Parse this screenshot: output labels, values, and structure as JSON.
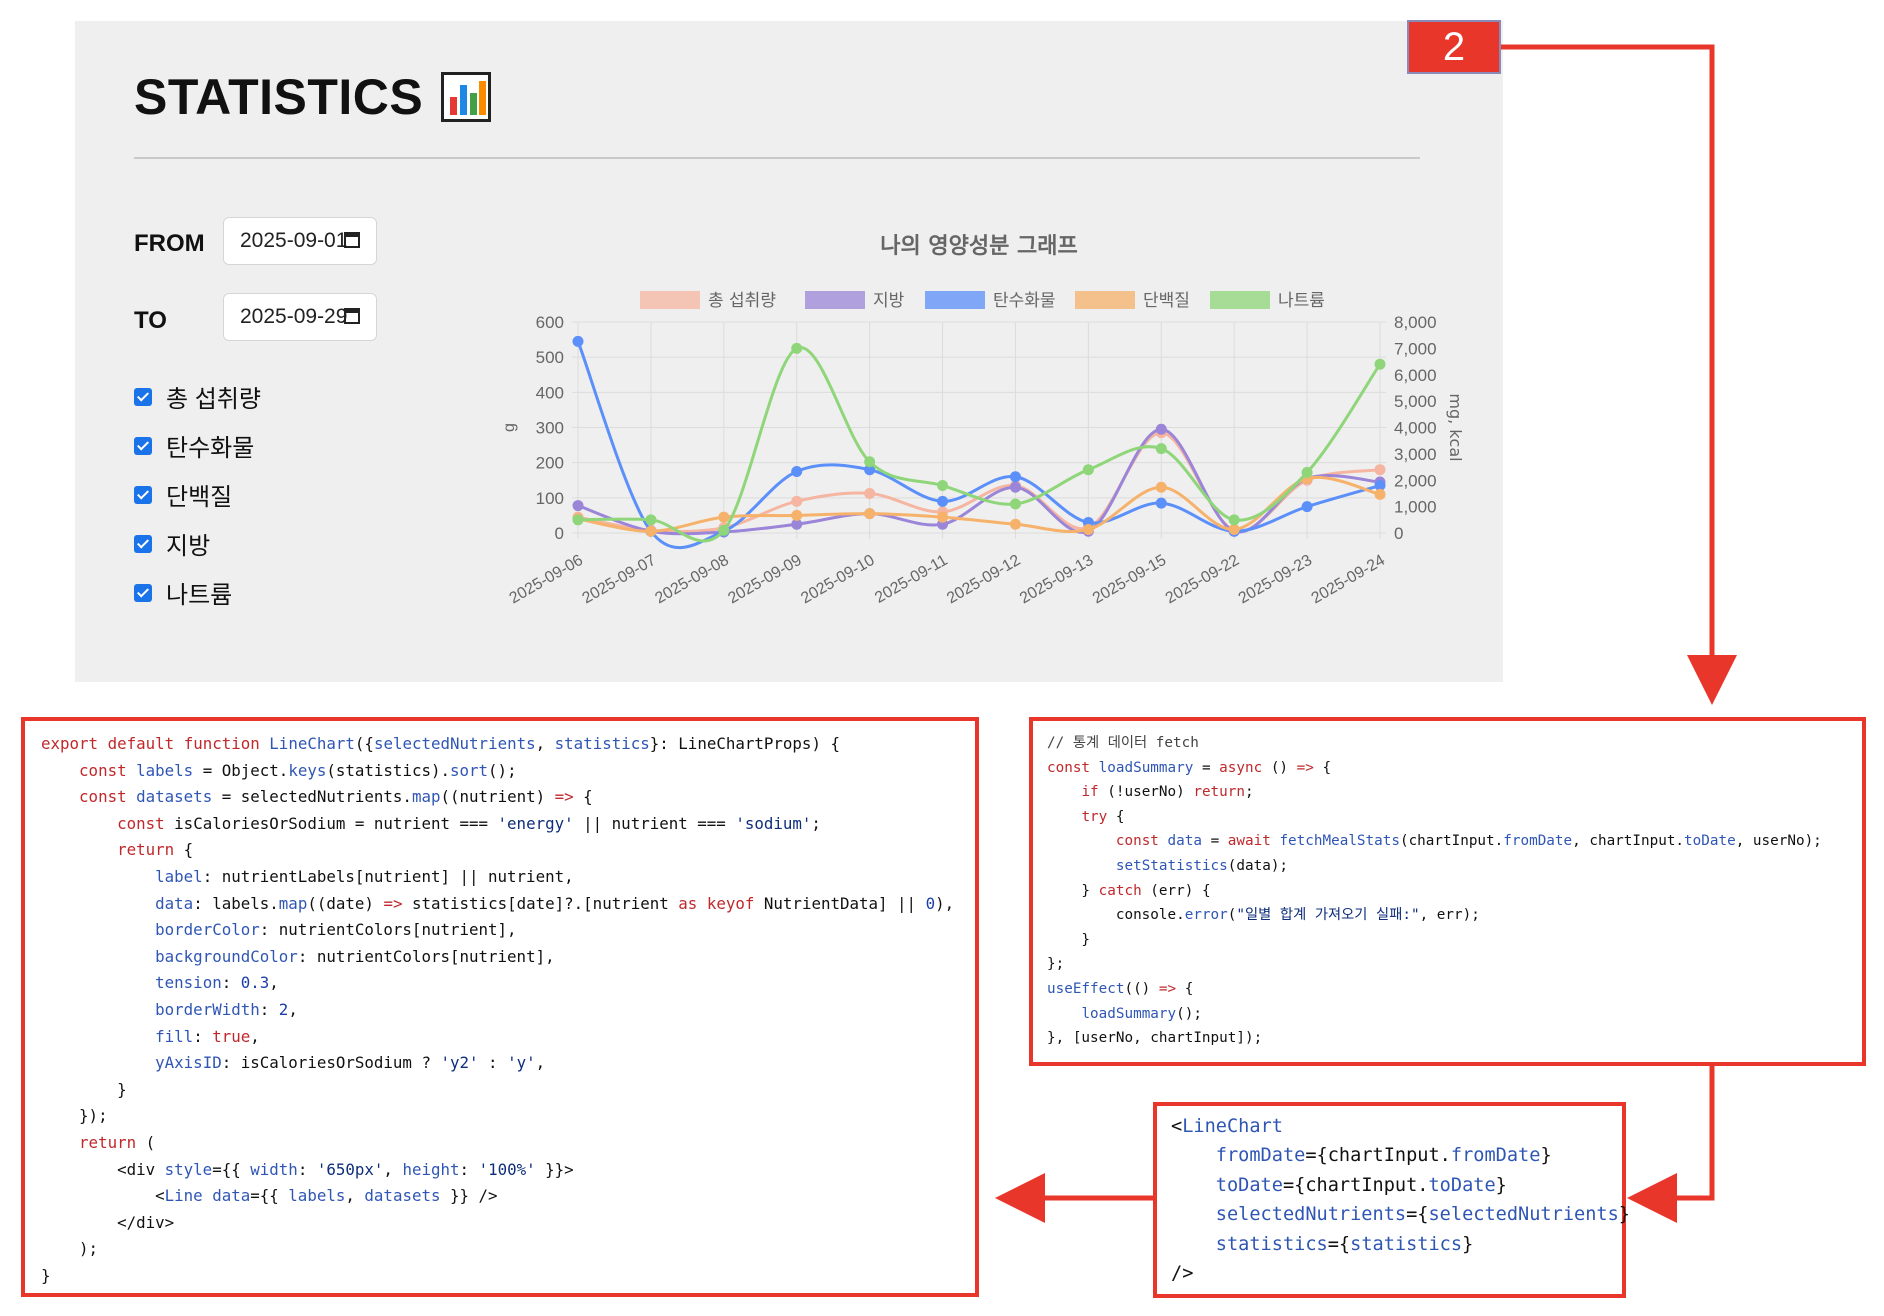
{
  "panel": {
    "title": "STATISTICS",
    "title_icon": "bar-chart-emoji-icon",
    "from_label": "FROM",
    "from_value": "2025-09-01",
    "to_label": "TO",
    "to_value": "2025-09-29",
    "checkboxes": [
      {
        "label": "총 섭취량",
        "checked": true
      },
      {
        "label": "탄수화물",
        "checked": true
      },
      {
        "label": "단백질",
        "checked": true
      },
      {
        "label": "지방",
        "checked": true
      },
      {
        "label": "나트륨",
        "checked": true
      }
    ]
  },
  "badge": {
    "text": "2",
    "color": "#e8362b"
  },
  "chart_data": {
    "type": "line",
    "title": "나의 영양성분 그래프",
    "categories": [
      "2025-09-06",
      "2025-09-07",
      "2025-09-08",
      "2025-09-09",
      "2025-09-10",
      "2025-09-11",
      "2025-09-12",
      "2025-09-13",
      "2025-09-15",
      "2025-09-22",
      "2025-09-23",
      "2025-09-24"
    ],
    "ylabel": "g",
    "y2label": "mg, kcal",
    "ylim": [
      0,
      600
    ],
    "y2lim": [
      0,
      8000
    ],
    "yticks": [
      0,
      100,
      200,
      300,
      400,
      500,
      600
    ],
    "y2ticks": [
      "0",
      "1,000",
      "2,000",
      "3,000",
      "4,000",
      "5,000",
      "6,000",
      "7,000",
      "8,000"
    ],
    "grid": true,
    "legend_position": "top",
    "series": [
      {
        "name": "총 섭취량",
        "axis": "y2",
        "color": "#f5b5a0",
        "values": [
          600,
          100,
          200,
          1200,
          1500,
          800,
          1800,
          200,
          3800,
          100,
          2000,
          2400
        ]
      },
      {
        "name": "지방",
        "axis": "y",
        "color": "#9b85d8",
        "values": [
          78,
          5,
          3,
          25,
          55,
          25,
          130,
          5,
          295,
          5,
          155,
          145
        ]
      },
      {
        "name": "탄수화물",
        "axis": "y",
        "color": "#5b8ff9",
        "values": [
          545,
          5,
          5,
          175,
          180,
          90,
          160,
          30,
          85,
          5,
          75,
          135
        ]
      },
      {
        "name": "단백질",
        "axis": "y",
        "color": "#f6b26b",
        "values": [
          40,
          5,
          45,
          50,
          55,
          45,
          25,
          10,
          130,
          10,
          155,
          110
        ]
      },
      {
        "name": "나트륨",
        "axis": "y2",
        "color": "#8fd67a",
        "values": [
          500,
          500,
          100,
          7000,
          2700,
          1800,
          1100,
          2400,
          3200,
          500,
          2300,
          6400
        ]
      }
    ]
  },
  "code_linechart": [
    "export default function LineChart({selectedNutrients, statistics}: LineChartProps) {",
    "    const labels = Object.keys(statistics).sort();",
    "    const datasets = selectedNutrients.map((nutrient) => {",
    "        const isCaloriesOrSodium = nutrient === 'energy' || nutrient === 'sodium';",
    "        return {",
    "            label: nutrientLabels[nutrient] || nutrient,",
    "            data: labels.map((date) => statistics[date]?.[nutrient as keyof NutrientData] || 0),",
    "            borderColor: nutrientColors[nutrient],",
    "            backgroundColor: nutrientColors[nutrient],",
    "            tension: 0.3,",
    "            borderWidth: 2,",
    "            fill: true,",
    "            yAxisID: isCaloriesOrSodium ? 'y2' : 'y',",
    "        }",
    "    });",
    "    return (",
    "        <div style={{ width: '650px', height: '100%' }}>",
    "            <Line data={{ labels, datasets }} />",
    "        </div>",
    "    );",
    "}"
  ],
  "code_fetch": [
    "// 통계 데이터 fetch",
    "const loadSummary = async () => {",
    "    if (!userNo) return;",
    "    try {",
    "        const data = await fetchMealStats(chartInput.fromDate, chartInput.toDate, userNo);",
    "        setStatistics(data);",
    "    } catch (err) {",
    "        console.error(\"일별 합계 가져오기 실패:\", err);",
    "    }",
    "};",
    "useEffect(() => {",
    "    loadSummary();",
    "}, [userNo, chartInput]);"
  ],
  "code_usage": [
    "<LineChart",
    "    fromDate={chartInput.fromDate}",
    "    toDate={chartInput.toDate}",
    "    selectedNutrients={selectedNutrients}",
    "    statistics={statistics}",
    "/>"
  ]
}
